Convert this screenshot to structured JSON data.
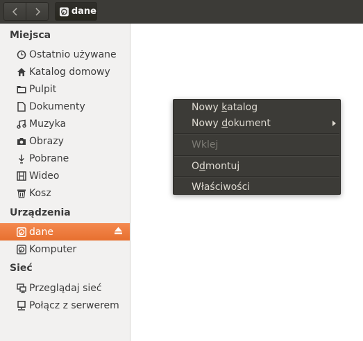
{
  "header": {
    "back_icon": "chevron-left-icon",
    "forward_icon": "chevron-right-icon",
    "path_label": "dane"
  },
  "sidebar": {
    "places_title": "Miejsca",
    "places": [
      {
        "label": "Ostatnio używane",
        "icon": "clock-icon"
      },
      {
        "label": "Katalog domowy",
        "icon": "home-icon"
      },
      {
        "label": "Pulpit",
        "icon": "folder-icon"
      },
      {
        "label": "Dokumenty",
        "icon": "document-icon"
      },
      {
        "label": "Muzyka",
        "icon": "music-icon"
      },
      {
        "label": "Obrazy",
        "icon": "camera-icon"
      },
      {
        "label": "Pobrane",
        "icon": "download-icon"
      },
      {
        "label": "Wideo",
        "icon": "film-icon"
      },
      {
        "label": "Kosz",
        "icon": "trash-icon"
      }
    ],
    "devices_title": "Urządzenia",
    "devices": [
      {
        "label": "dane",
        "icon": "drive-icon",
        "active": true
      },
      {
        "label": "Komputer",
        "icon": "drive-icon"
      }
    ],
    "network_title": "Sieć",
    "network": [
      {
        "label": "Przeglądaj sieć",
        "icon": "network-icon"
      },
      {
        "label": "Połącz z serwerem",
        "icon": "server-icon"
      }
    ]
  },
  "context_menu": {
    "new_folder": {
      "pre": "Nowy ",
      "u": "k",
      "post": "atalog"
    },
    "new_document": {
      "pre": "Nowy ",
      "u": "d",
      "post": "okument"
    },
    "paste": "Wklej",
    "unmount": {
      "pre": "O",
      "u": "d",
      "post": "montuj"
    },
    "properties": "Właściwości"
  },
  "colors": {
    "header_bg": "#3c3b37",
    "sidebar_bg": "#f2f1f0",
    "active_accent": "#e9753a",
    "menu_bg": "#3c3b37"
  }
}
